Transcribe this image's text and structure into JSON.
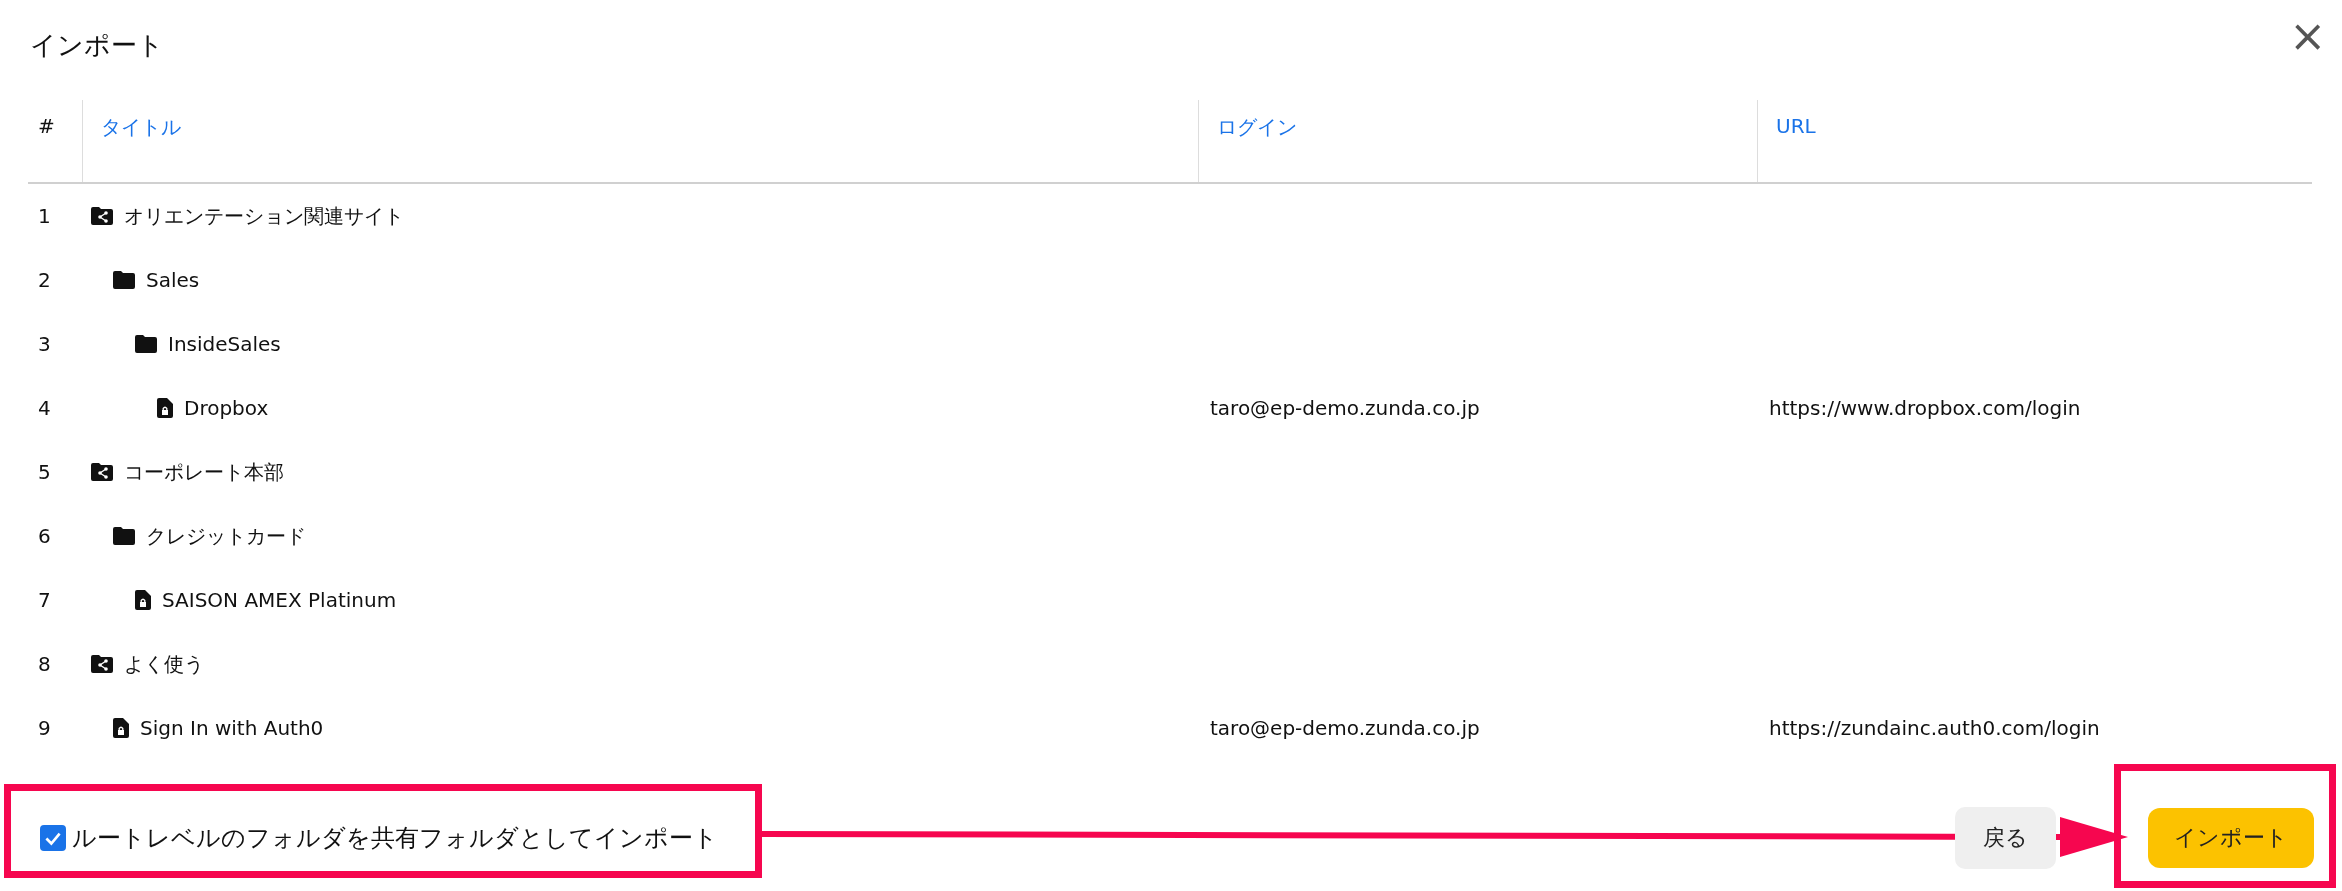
{
  "dialog": {
    "title": "インポート",
    "close": "×"
  },
  "table": {
    "columns": [
      "#",
      "タイトル",
      "ログイン",
      "URL"
    ],
    "rows": [
      {
        "number": "1",
        "kind": "shared-folder",
        "title": "オリエンテーション関連サイト",
        "children": [
          {
            "number": "2",
            "kind": "folder",
            "title": "Sales",
            "children": [
              {
                "number": "3",
                "kind": "folder",
                "title": "InsideSales",
                "children": [
                  {
                    "number": "4",
                    "kind": "item",
                    "title": "Dropbox",
                    "login": "taro@ep-demo.zunda.co.jp",
                    "url": "https://www.dropbox.com/login"
                  }
                ]
              }
            ]
          }
        ]
      },
      {
        "number": "5",
        "kind": "shared-folder",
        "title": "コーポレート本部",
        "children": [
          {
            "number": "6",
            "kind": "folder",
            "title": "クレジットカード",
            "children": [
              {
                "number": "7",
                "kind": "item",
                "title": "SAISON AMEX Platinum"
              }
            ]
          }
        ]
      },
      {
        "number": "8",
        "kind": "shared-folder",
        "title": "よく使う",
        "children": [
          {
            "number": "9",
            "kind": "item",
            "title": "Sign In with Auth0",
            "login": "taro@ep-demo.zunda.co.jp",
            "url": "https://zundainc.auth0.com/login"
          }
        ]
      }
    ]
  },
  "option": {
    "label": "ルートレベルのフォルダを共有フォルダとしてインポート",
    "checked": true
  },
  "buttons": {
    "back": "戻る",
    "import": "インポート"
  }
}
